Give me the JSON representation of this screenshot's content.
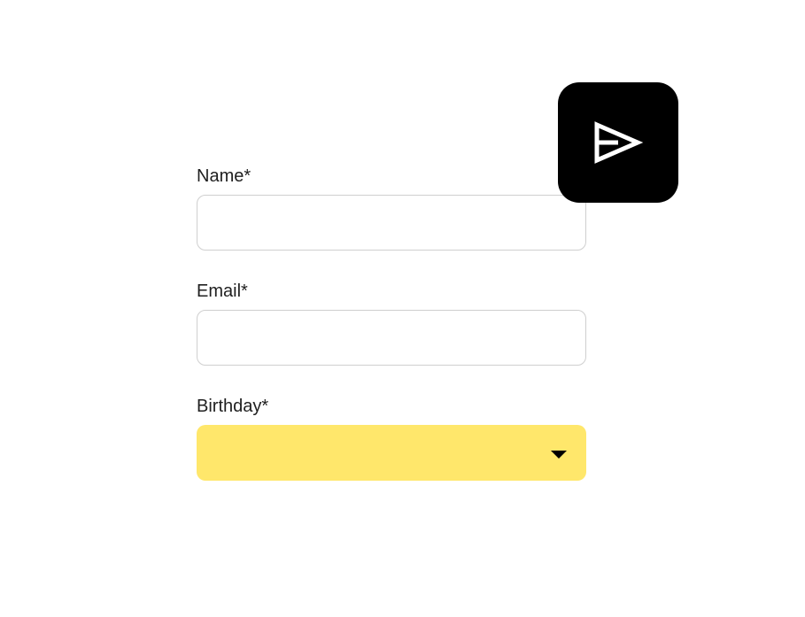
{
  "form": {
    "fields": [
      {
        "label": "Name*",
        "value": "",
        "placeholder": ""
      },
      {
        "label": "Email*",
        "value": "",
        "placeholder": ""
      },
      {
        "label": "Birthday*",
        "selected": ""
      }
    ]
  },
  "send_button": {
    "icon": "send-icon",
    "background": "#000000",
    "icon_color": "#ffffff"
  },
  "colors": {
    "select_background": "#ffe76b",
    "input_border": "#cfcfcf"
  }
}
